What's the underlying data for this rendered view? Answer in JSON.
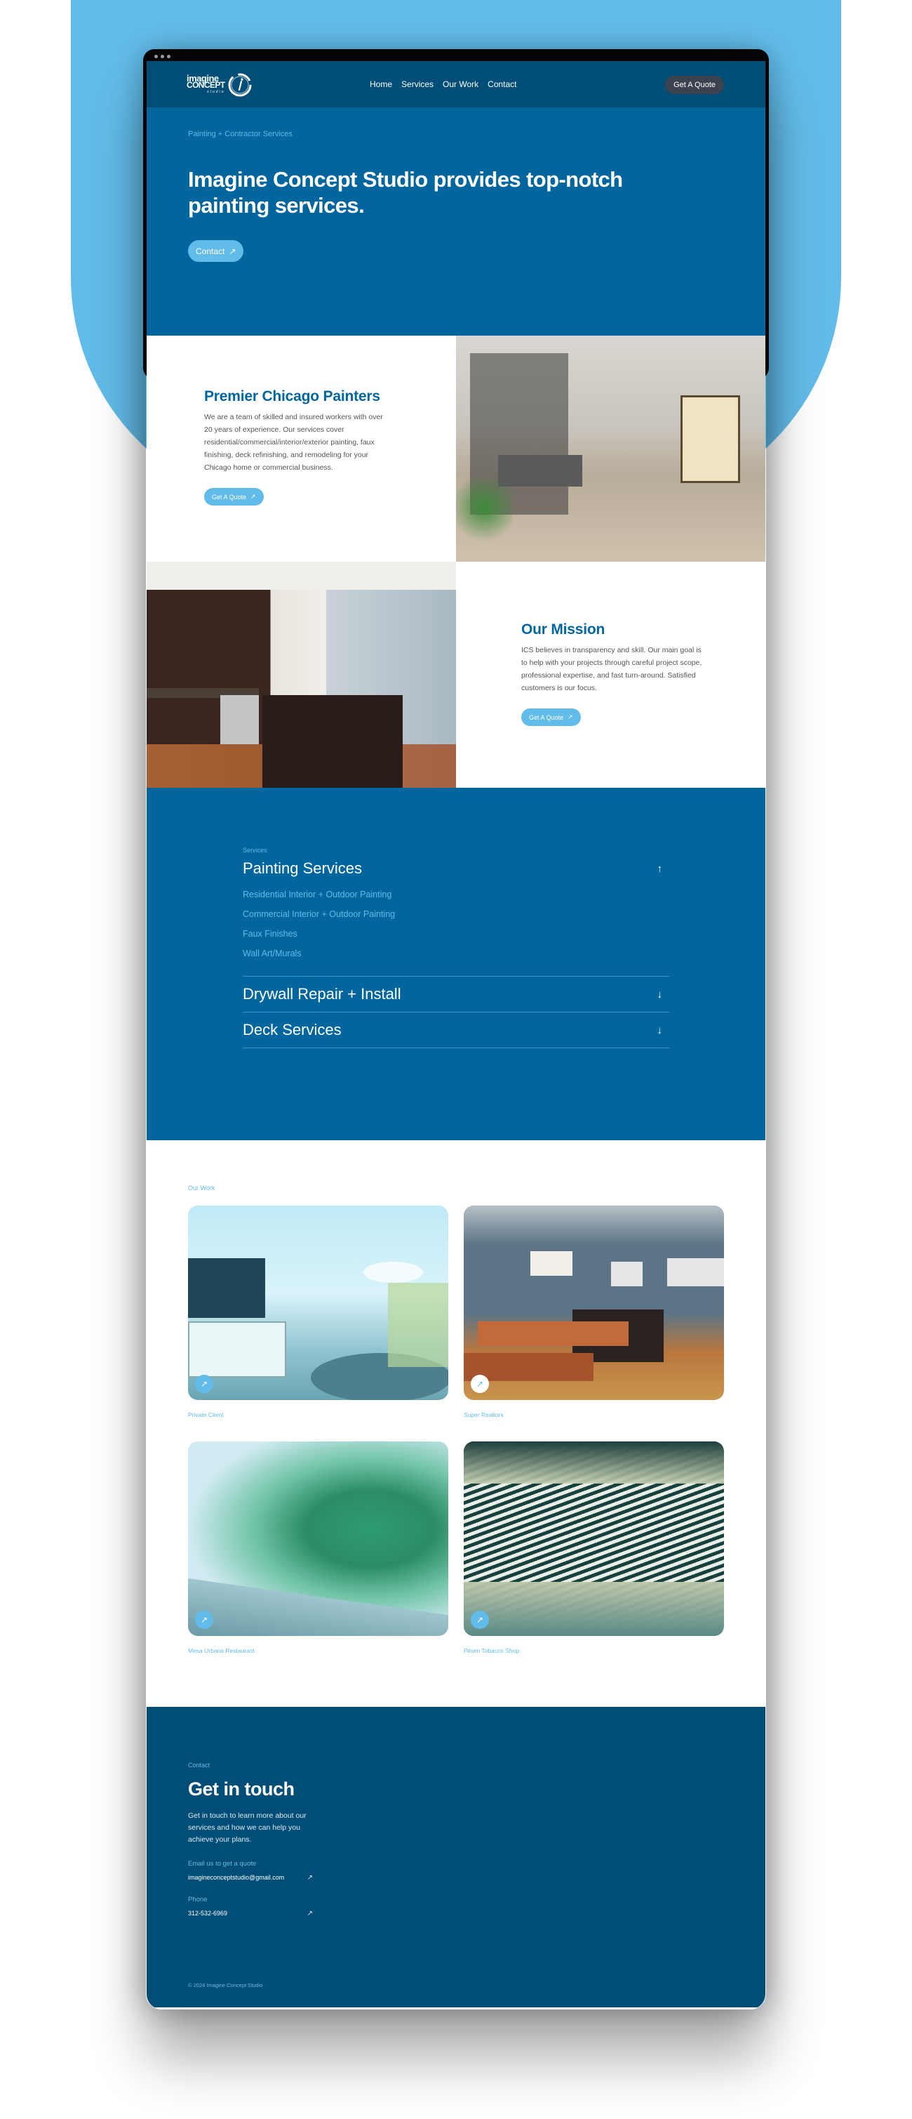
{
  "browser": {
    "dots": 3
  },
  "header": {
    "logo": {
      "line1": "imagine",
      "line2": "CONCEPT",
      "line3": "studio",
      "mark_icon": "brush-circle-i-icon"
    },
    "nav": [
      "Home",
      "Services",
      "Our Work",
      "Contact"
    ],
    "quote_button": "Get A Quote"
  },
  "hero": {
    "kicker": "Painting + Contractor Services",
    "title": "Imagine Concept Studio provides top-notch painting services.",
    "button": "Contact",
    "button_icon": "↗"
  },
  "features": [
    {
      "title": "Premier Chicago Painters",
      "body": "We are a team of skilled and insured workers with over 20 years of experience. Our services cover residential/commercial/interior/exterior painting, faux finishing, deck refinishing, and remodeling for your Chicago home or commercial business.",
      "button": "Get A Quote",
      "image": "lobby interior photo"
    },
    {
      "title": "Our Mission",
      "body": "ICS believes in transparency and skill. Our main goal is to help with your projects through careful project scope, professional expertise, and fast turn-around. Satisfied customers is our focus.",
      "button": "Get A Quote",
      "image": "kitchen interior photo"
    }
  ],
  "services": {
    "kicker": "Services",
    "items": [
      {
        "title": "Painting Services",
        "expanded": true,
        "arrow": "↑",
        "subitems": [
          "Residential Interior + Outdoor Painting",
          "Commercial Interior + Outdoor Painting",
          "Faux Finishes",
          "Wall Art/Murals"
        ]
      },
      {
        "title": "Drywall Repair + Install",
        "expanded": false,
        "arrow": "↓"
      },
      {
        "title": "Deck Services",
        "expanded": false,
        "arrow": "↓"
      }
    ]
  },
  "work": {
    "kicker": "Our Work",
    "items": [
      {
        "label": "Private Client",
        "image": "dining room photo",
        "badge": "↗"
      },
      {
        "label": "Super Realtors",
        "image": "kitchen with blue walls photo",
        "badge": "↗"
      },
      {
        "label": "Mesa Urbana Restaurant",
        "image": "agave mural photo",
        "badge": "↗"
      },
      {
        "label": "Pilsen Tobacco Shop",
        "image": "striped wave mural photo",
        "badge": "↗"
      }
    ]
  },
  "contact": {
    "kicker": "Contact",
    "title": "Get in touch",
    "body": "Get in touch to learn more about our services and how we can help you achieve your plans.",
    "email_label": "Email us to get a quote",
    "email": "imagineconceptstudio@gmail.com",
    "phone_label": "Phone",
    "phone": "312-532-6969",
    "arrow": "↗",
    "copyright": "© 2024 Imagine Concept Studio"
  },
  "colors": {
    "light_blue": "#62bce9",
    "primary_blue": "#00669d",
    "dark_blue": "#004e77",
    "quote_button": "#3d4250"
  }
}
